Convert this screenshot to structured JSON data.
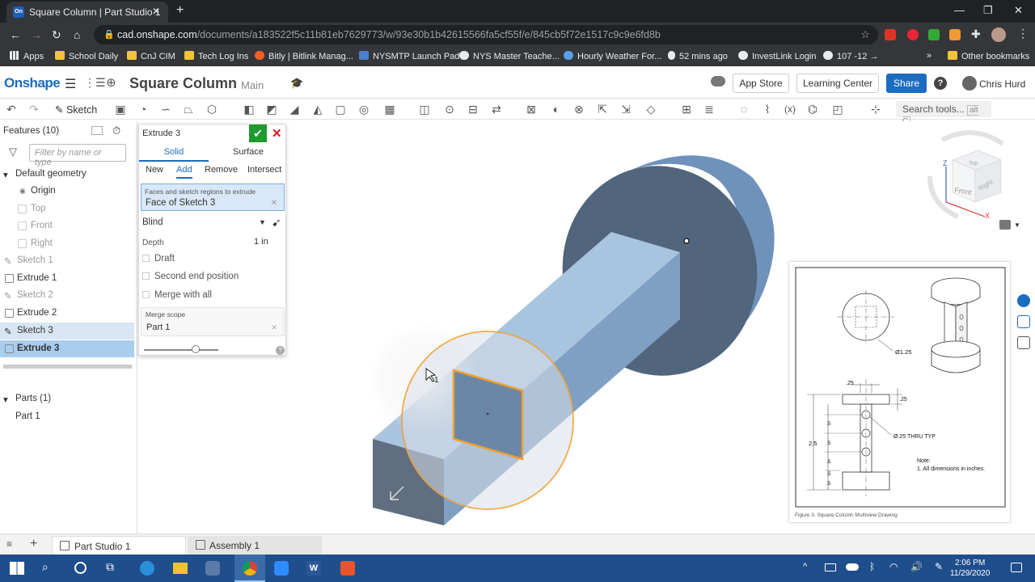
{
  "browser": {
    "tab_title": "Square Column | Part Studio 1",
    "tab_favicon": "On",
    "url_host": "cad.onshape.com",
    "url_path": "/documents/a183522f5c11b81eb7629773/w/93e30b1b42615566fa5cf55f/e/845cb5f72e1517c9c9e6fd8b",
    "bookmarks": [
      "Apps",
      "School Daily",
      "CnJ CIM",
      "Tech Log Ins",
      "Bitly | Bitlink Manag...",
      "NYSMTP Launch Pad",
      "NYS Master Teache...",
      "Hourly Weather For...",
      "52 mins ago",
      "InvestLink Login",
      "107 -12 →",
      "Other bookmarks"
    ]
  },
  "app": {
    "logo": "Onshape",
    "doc_title": "Square Column",
    "branch": "Main",
    "app_store": "App Store",
    "learning_center": "Learning Center",
    "share": "Share",
    "user": "Chris Hurd",
    "sketch_btn": "Sketch",
    "search_tools": "Search tools...",
    "search_shortcut": "alt C"
  },
  "features": {
    "header": "Features (10)",
    "filter_placeholder": "Filter by name or type",
    "default_geometry": "Default geometry",
    "items": [
      "Origin",
      "Top",
      "Front",
      "Right",
      "Sketch 1",
      "Extrude 1",
      "Sketch 2",
      "Extrude 2",
      "Sketch 3",
      "Extrude 3"
    ],
    "parts_header": "Parts (1)",
    "parts": [
      "Part 1"
    ]
  },
  "dialog": {
    "title": "Extrude 3",
    "tabs": [
      "Solid",
      "Surface"
    ],
    "ops": [
      "New",
      "Add",
      "Remove",
      "Intersect"
    ],
    "faces_label": "Faces and sketch regions to extrude",
    "faces_value": "Face of Sketch 3",
    "end_type": "Blind",
    "depth_label": "Depth",
    "depth_value": "1 in",
    "draft": "Draft",
    "second_end": "Second end position",
    "merge_all": "Merge with all",
    "merge_scope_label": "Merge scope",
    "merge_scope_value": "Part 1"
  },
  "viewcube": {
    "top": "Top",
    "front": "Front",
    "right": "Right",
    "z": "Z",
    "x": "X"
  },
  "drawing": {
    "dim_dia": "Ø1.25",
    "dim_25_top": ".25",
    "dim_25_right": ".25",
    "dim_height": "2.5",
    "dim_5s": [
      ".5",
      ".5",
      ".5",
      ".5",
      ".5"
    ],
    "hole_note": "Ø.25 THRU TYP",
    "note_title": "Note:",
    "note_text": "1. All dimensions in inches.",
    "caption": "Figure 3. Square Column Multiview Drawing"
  },
  "bottom_tabs": [
    "Part Studio 1",
    "Assembly 1"
  ],
  "taskbar": {
    "time": "2:06 PM",
    "date": "11/29/2020"
  },
  "colors": {
    "accent": "#1c6cc0",
    "part": "#8fb2d6",
    "part_dark": "#5a6f86",
    "highlight": "#f0a030"
  }
}
